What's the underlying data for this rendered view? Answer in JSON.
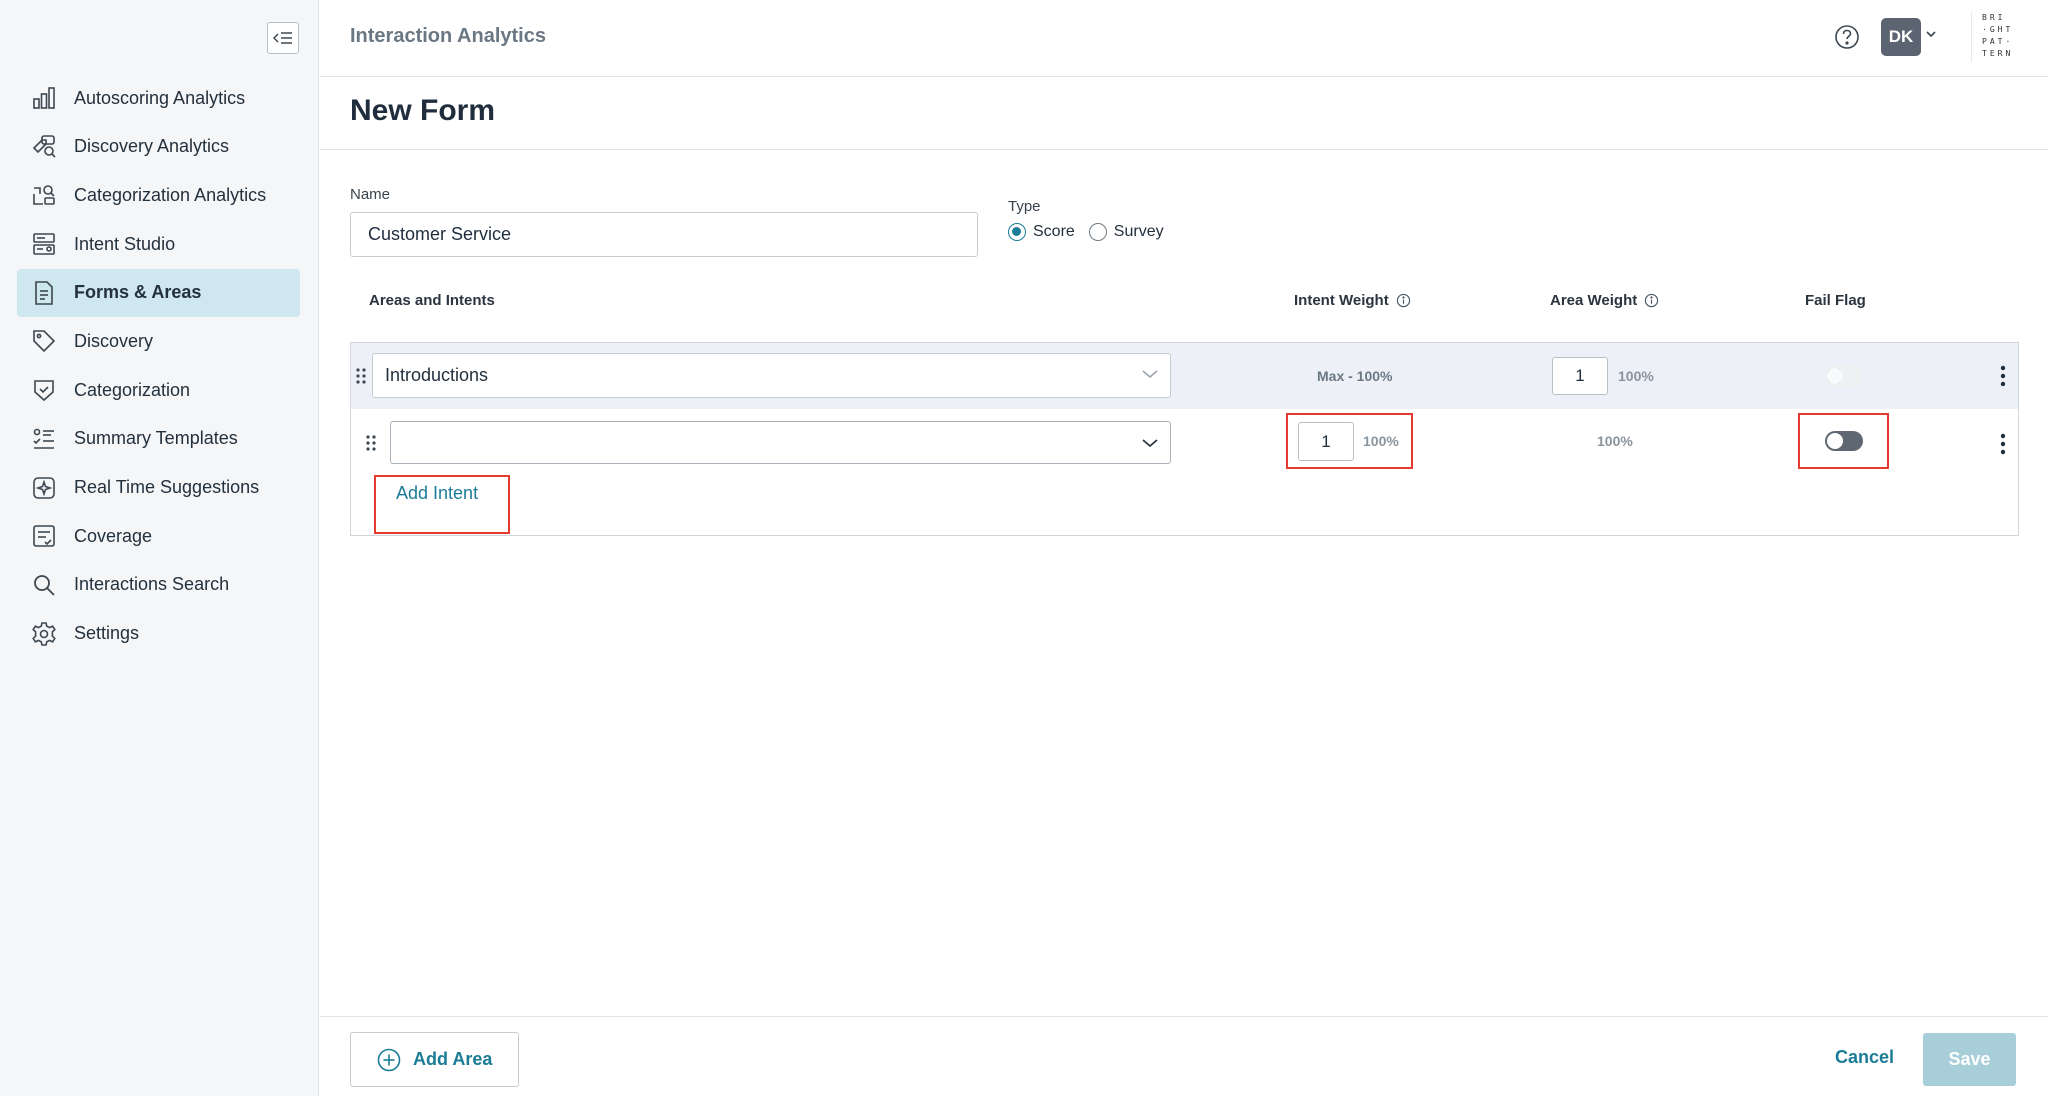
{
  "header": {
    "app_title": "Interaction Analytics",
    "user_initials": "DK",
    "logo_lines": [
      "BRI",
      "·GHT",
      "PAT·",
      "TERN"
    ]
  },
  "sidebar": {
    "items": [
      {
        "label": "Autoscoring Analytics",
        "icon": "bar-chart-icon",
        "active": false
      },
      {
        "label": "Discovery Analytics",
        "icon": "tag-search-icon",
        "active": false
      },
      {
        "label": "Categorization Analytics",
        "icon": "category-search-icon",
        "active": false
      },
      {
        "label": "Intent Studio",
        "icon": "intent-studio-icon",
        "active": false
      },
      {
        "label": "Forms & Areas",
        "icon": "form-document-icon",
        "active": true
      },
      {
        "label": "Discovery",
        "icon": "tag-icon",
        "active": false
      },
      {
        "label": "Categorization",
        "icon": "categorization-icon",
        "active": false
      },
      {
        "label": "Summary Templates",
        "icon": "summary-list-icon",
        "active": false
      },
      {
        "label": "Real Time Suggestions",
        "icon": "sparkle-icon",
        "active": false
      },
      {
        "label": "Coverage",
        "icon": "coverage-icon",
        "active": false
      },
      {
        "label": "Interactions Search",
        "icon": "search-icon",
        "active": false
      },
      {
        "label": "Settings",
        "icon": "gear-icon",
        "active": false
      }
    ]
  },
  "page": {
    "title": "New Form"
  },
  "form": {
    "name_label": "Name",
    "name_value": "Customer Service",
    "type_label": "Type",
    "type_options": [
      "Score",
      "Survey"
    ],
    "type_selected": "Score"
  },
  "table": {
    "headers": {
      "areas_intents": "Areas and Intents",
      "intent_weight": "Intent Weight",
      "area_weight": "Area Weight",
      "fail_flag": "Fail Flag"
    },
    "area_row": {
      "area_name": "Introductions",
      "max_text": "Max - 100%",
      "area_weight": "1",
      "area_pct": "100%",
      "fail_flag_on": false
    },
    "intent_row": {
      "intent_value": "",
      "intent_weight": "1",
      "intent_pct": "100%",
      "area_pct": "100%",
      "fail_flag_on": false
    },
    "add_intent_label": "Add Intent"
  },
  "footer": {
    "add_area_label": "Add Area",
    "cancel_label": "Cancel",
    "save_label": "Save"
  },
  "colors": {
    "accent": "#1a7c96",
    "active_nav": "#cfe8ef",
    "highlight": "#e53a2d",
    "save_disabled": "#a8cfd9"
  }
}
